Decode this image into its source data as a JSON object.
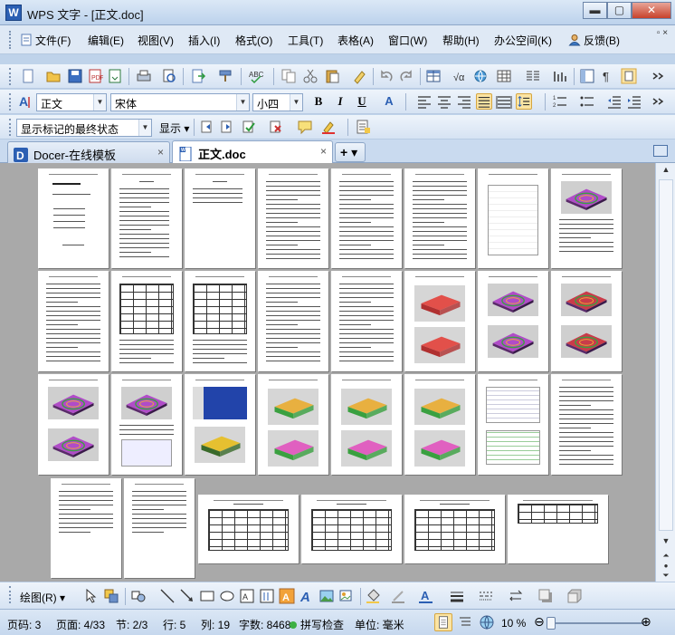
{
  "app": {
    "logo_text": "W",
    "title": "WPS 文字 - [正文.doc]",
    "min_glyph": "▬",
    "max_glyph": "▢",
    "close_glyph": "✕"
  },
  "menu": {
    "items": [
      {
        "label": "文件(F)"
      },
      {
        "label": "编辑(E)"
      },
      {
        "label": "视图(V)"
      },
      {
        "label": "插入(I)"
      },
      {
        "label": "格式(O)"
      },
      {
        "label": "工具(T)"
      },
      {
        "label": "表格(A)"
      },
      {
        "label": "窗口(W)"
      },
      {
        "label": "帮助(H)"
      },
      {
        "label": "办公空间(K)"
      },
      {
        "label": "反馈(B)"
      }
    ],
    "mdi": "▫ ×"
  },
  "formatting": {
    "style_value": "正文",
    "font_value": "宋体",
    "size_value": "小四",
    "bold": "B",
    "italic": "I",
    "underline": "U",
    "fontcolor": "A"
  },
  "review": {
    "markup_value": "显示标记的最终状态",
    "show_label": "显示"
  },
  "tabs": [
    {
      "label": "Docer-在线模板",
      "close": "×"
    },
    {
      "label": "正文.doc",
      "close": "×"
    }
  ],
  "tab_add": "+ ▾",
  "drawbar": {
    "draw_label": "绘图(R)"
  },
  "status": {
    "page_no": "页码: 3",
    "page_of": "页面: 4/33",
    "section": "节: 2/3",
    "row": "行: 5",
    "col": "列: 19",
    "words": "字数: 8468",
    "spellcheck": "拼写检查",
    "unit": "单位: 毫米",
    "zoom": "10 %"
  },
  "colors": {
    "accent": "#2b5fb3",
    "bg": "#bfd3ea",
    "doc_bg": "#a9a9a9",
    "model_purple": "#b04cc8",
    "model_red": "#c93c4a",
    "model_orange": "#f0b030",
    "model_green": "#3aa040"
  }
}
